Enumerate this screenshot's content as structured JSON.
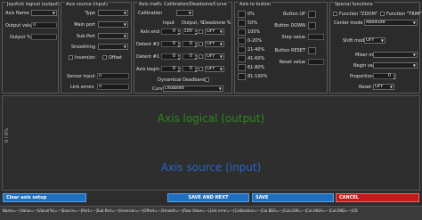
{
  "joystick": {
    "title": "Joystick logical (output)",
    "axis_name_label": "Axis Name",
    "axis_name_value": "",
    "output_value_label": "Output value",
    "output_value": "0",
    "output_pct_label": "Output %",
    "output_pct": ""
  },
  "source": {
    "title": "Axis source (input)",
    "type_label": "Type",
    "main_port_label": "Main port",
    "sub_port_label": "Sub.Port",
    "smoothing_label": "Smoothing",
    "inversion_label": "Inversion",
    "offset_label": "Offset",
    "sensor_input_label": "Sensor input",
    "sensor_input_value": "0",
    "link_errors_label": "Link errors",
    "link_errors_value": "0"
  },
  "math": {
    "title": "Axis math: Calibration/Deadzone/Curve",
    "calibration_label": "Calibration",
    "col_input": "Input",
    "col_output": "Output, %",
    "col_deadzone": "Deadzone %",
    "rows": [
      {
        "label": "Axis end",
        "input": "0",
        "output": "100",
        "dz": "OFF"
      },
      {
        "label": "Detent #2",
        "input": "0",
        "output": "0",
        "dz": "OFF"
      },
      {
        "label": "Detent #1",
        "input": "0",
        "output": "0",
        "dz": "OFF"
      },
      {
        "label": "Axis begin",
        "input": "0",
        "output": "0",
        "dz": "OFF"
      }
    ],
    "dyn_deadband_label": "Dynamical Deadband",
    "curve_label": "Curve",
    "curve_value": "Disabled"
  },
  "a2b": {
    "title": "Axis to button",
    "ranges": [
      "0%",
      "50%",
      "100%",
      "0-20%",
      "21-40%",
      "41-60%",
      "61-80%",
      "81-100%"
    ]
  },
  "btns": {
    "button_up_label": "Button UP",
    "button_down_label": "Button DOWN",
    "step_value_label": "Step value",
    "button_reset_label": "Button RESET",
    "reset_value_label": "Reset value"
  },
  "special": {
    "title": "Special functions",
    "zoom_label": "Function \"ZOOM\"",
    "trim_label": "Function \"TRIM\"",
    "center_mode_label": "Center mode",
    "center_mode_value": "Absolute",
    "shift_mode_label": "Shift mode",
    "shift_mode_value": "OFF",
    "mixer_mode_label": "Mixer mode",
    "begin_value_label": "Begin value",
    "proportion_label": "Proportion(%)",
    "proportion_value": "0",
    "reset_axis_label": "Reset axis",
    "reset_axis_value": "OFF"
  },
  "graph": {
    "logical_label": "Axis logical (output)",
    "source_label": "Axis source (input)",
    "zero_label": "0 / 0%"
  },
  "buttons": {
    "clear": "Clear axis setup",
    "save_next": "SAVE AND NEXT",
    "save": "SAVE",
    "cancel": "CANCEL"
  },
  "status": "Name=—|Value=—|Value(%)=—|Source=—|Port=—|Sub.Port=—|Inversion=—|Offset=—|Smooth=—|Raw Value=—|Link error=—|Calibration=—|Cal.BEG=—|Cal.LOW=—|Cal.HIGH=—|Cal.END=—|CD",
  "colors": {
    "bg": "#2d2d2d",
    "blue": "#1f6fbf",
    "red": "#c21a1a",
    "accent_green": "#2c8a1c",
    "accent_blue": "#2a62c8"
  }
}
